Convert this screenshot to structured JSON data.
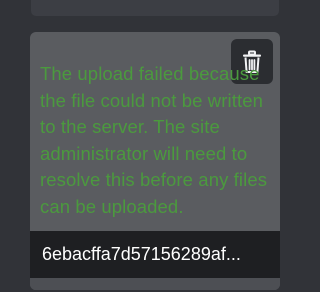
{
  "upload_error": {
    "message": "The upload failed because the file could not be written to the server. The site administrator will need to resolve this before any files can be uploaded.",
    "filename": "6ebacffa7d57156289af...",
    "delete_icon": "trash-icon",
    "colors": {
      "message_text": "#4b9a3e",
      "card_background": "#5a5c60",
      "filename_bar": "#1e1f22",
      "button_background": "#2b2d31"
    }
  }
}
